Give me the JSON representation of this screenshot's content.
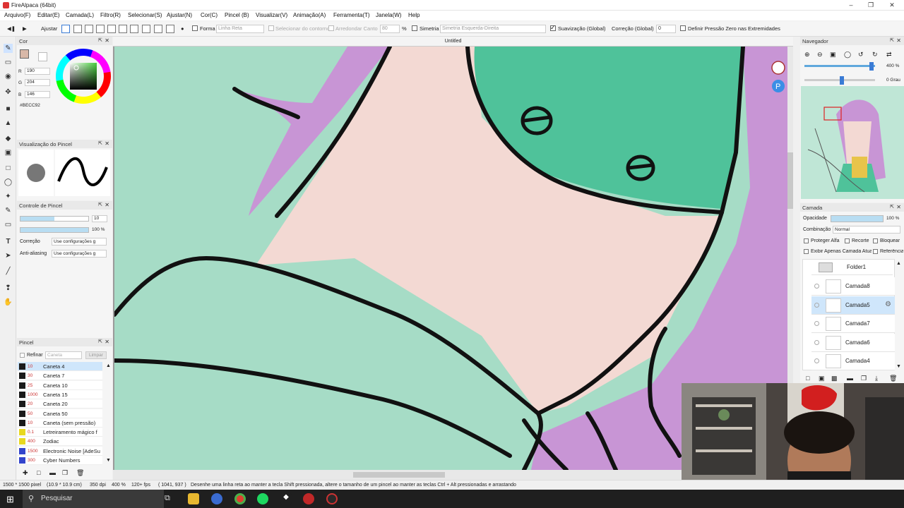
{
  "window": {
    "title": "FireAlpaca (64bit)"
  },
  "menu": [
    "Arquivo(F)",
    "Editar(E)",
    "Camada(L)",
    "Filtro(R)",
    "Selecionar(S)",
    "Ajustar(N)",
    "Cor(C)",
    "Pincel (B)",
    "Visualizar(V)",
    "Animação(A)",
    "Ferramenta(T)",
    "Janela(W)",
    "Help"
  ],
  "toolbar": {
    "ajustar": "Ajustar",
    "forma": "Forma",
    "forma_value": "Linha Reta",
    "selecionar_contorno": "Selecionar do contorno",
    "arredondar_canto": "Arredondar Canto",
    "arredondar_value": "80",
    "pct": "%",
    "simetria": "Simetria",
    "simetria_value": "Simetria Esquerda-Direita",
    "suavizacao": "Suavização (Global)",
    "correcao": "Correção (Global)",
    "correcao_value": "0",
    "pressao": "Definir Pressão Zero nas Extremidades"
  },
  "color_panel": {
    "title": "Cor",
    "r_label": "R",
    "r": "190",
    "g_label": "G",
    "g": "204",
    "b_label": "B",
    "b": "146",
    "hex": "#BECC92",
    "swatch": "#d8b8a8"
  },
  "brush_preview": {
    "title": "Visualização do Pincel"
  },
  "brush_control": {
    "title": "Controle de Pincel",
    "size": "10",
    "opacity": "100 %",
    "correcao_label": "Correção",
    "correcao_value": "Use configurações g",
    "antialias_label": "Anti-aliasing",
    "antialias_value": "Use configurações g"
  },
  "brush_panel": {
    "title": "Pincel",
    "refinar": "Refinar",
    "caneta": "Caneta",
    "limpar": "Limpar",
    "items": [
      {
        "size": "10",
        "name": "Caneta 4",
        "color": "#1a1a1a",
        "selected": true
      },
      {
        "size": "30",
        "name": "Caneta 7",
        "color": "#1a1a1a"
      },
      {
        "size": "25",
        "name": "Caneta 10",
        "color": "#1a1a1a"
      },
      {
        "size": "1000",
        "name": "Caneta 15",
        "color": "#1a1a1a"
      },
      {
        "size": "20",
        "name": "Caneta 20",
        "color": "#1a1a1a"
      },
      {
        "size": "50",
        "name": "Caneta 50",
        "color": "#1a1a1a"
      },
      {
        "size": "10",
        "name": "Caneta (sem pressão)",
        "color": "#1a1a1a"
      },
      {
        "size": "0.1",
        "name": "Letreiramento mágico f",
        "color": "#e8d820"
      },
      {
        "size": "400",
        "name": "Zodiac",
        "color": "#e8d820"
      },
      {
        "size": "1500",
        "name": "Electronic Noise [AdeSu",
        "color": "#3344cc"
      },
      {
        "size": "300",
        "name": "Cyber Numbers",
        "color": "#3344cc"
      }
    ]
  },
  "canvas": {
    "tab": "Untitled"
  },
  "navigator": {
    "title": "Navegador",
    "zoom": "400 %",
    "angle": "0 Grau"
  },
  "layer_panel": {
    "title": "Camada",
    "opacidade": "Opacidade",
    "opacidade_value": "100 %",
    "combinacao": "Combinação",
    "combinacao_value": "Normal",
    "proteger": "Proteger Alfa",
    "recorte": "Recorte",
    "bloquear": "Bloquear",
    "exibir": "Exibir Apenas Camada Atual",
    "referencia": "Referência",
    "folder": "Folder1",
    "layers": [
      {
        "name": "Camada8",
        "selected": false
      },
      {
        "name": "Camada5",
        "selected": true
      },
      {
        "name": "Camada7",
        "selected": false
      },
      {
        "name": "Camada6",
        "selected": false
      },
      {
        "name": "Camada4",
        "selected": false
      }
    ]
  },
  "status": {
    "size": "1500 * 1500 pixel",
    "cm": "(10.9 * 10.9 cm)",
    "dpi": "350 dpi",
    "zoom": "400 %",
    "fps": "120+ fps",
    "coords": "( 1041, 937 )",
    "hint": "Desenhe uma linha reta ao manter a tecla Shift pressionada, altere o tamanho de um pincel ao manter as teclas Ctrl + Alt pressionadas e arrastando"
  },
  "taskbar": {
    "search": "Pesquisar"
  }
}
